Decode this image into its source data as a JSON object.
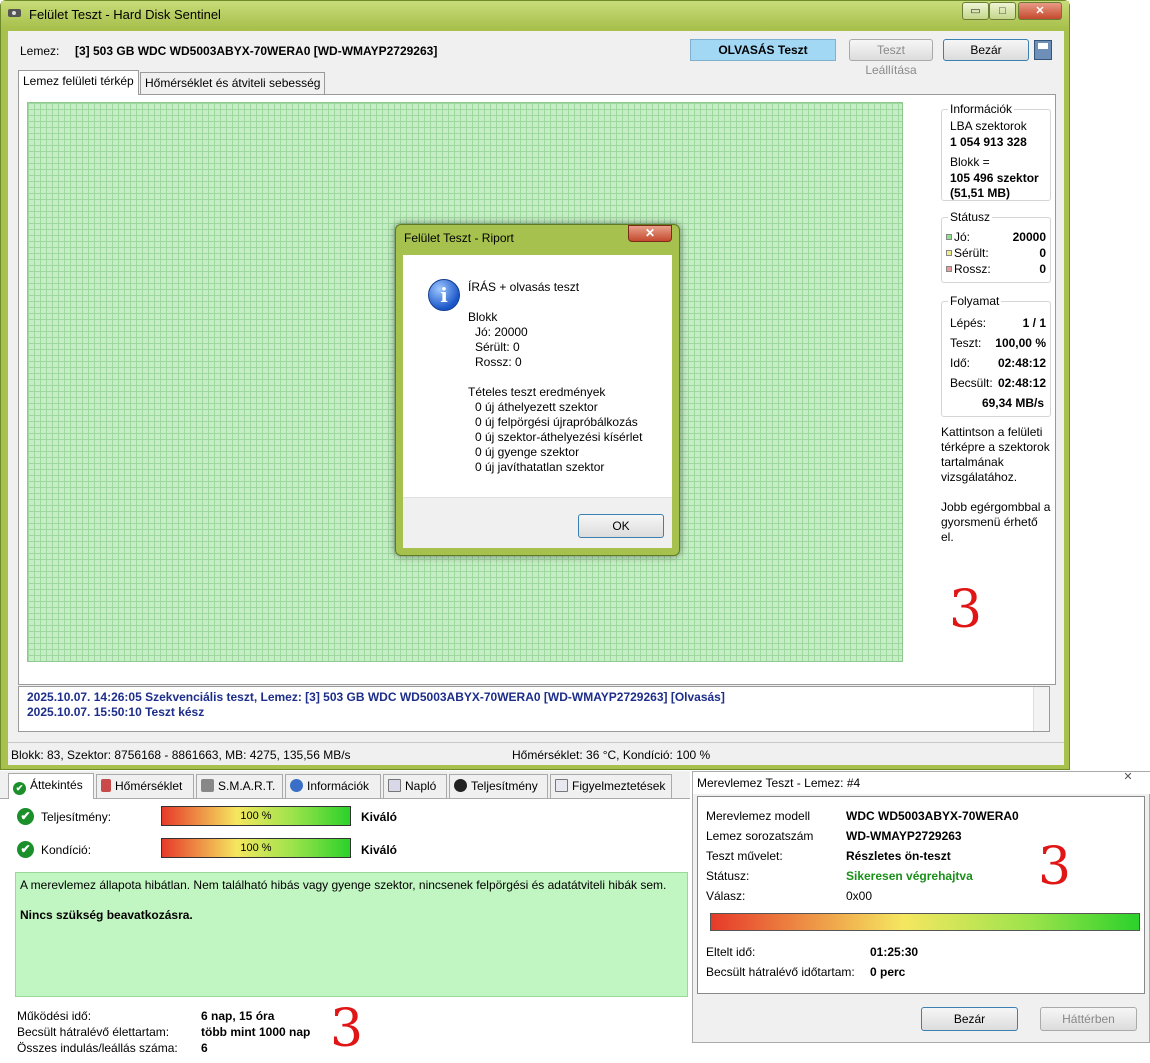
{
  "window": {
    "title": "Felület Teszt - Hard Disk Sentinel",
    "lemez_label": "Lemez:",
    "lemez_value": "[3] 503 GB  WDC WD5003ABYX-70WERA0 [WD-WMAYP2729263]",
    "test_mode": "OLVASÁS Teszt",
    "stop_button": "Teszt Leállítása",
    "close_button": "Bezár",
    "caption_buttons": [
      "▭",
      "□",
      "✕"
    ]
  },
  "tabs": [
    "Lemez felületi térkép",
    "Hőmérséklet és átviteli sebesség"
  ],
  "info": {
    "title": "Információk",
    "lba_label": "LBA szektorok",
    "lba_value": "1 054 913 328",
    "block_label": "Blokk =",
    "block_value": "105 496 szektor",
    "block_mb": "(51,51 MB)"
  },
  "status": {
    "title": "Státusz",
    "items": [
      {
        "label": "Jó:",
        "value": "20000",
        "color": "#8fe08f"
      },
      {
        "label": "Sérült:",
        "value": "0",
        "color": "#f2ec8a"
      },
      {
        "label": "Rossz:",
        "value": "0",
        "color": "#e99a9a"
      }
    ]
  },
  "progress": {
    "title": "Folyamat",
    "rows": [
      {
        "label": "Lépés:",
        "value": "1 / 1"
      },
      {
        "label": "Teszt:",
        "value": "100,00 %"
      },
      {
        "label": "Idő:",
        "value": "02:48:12"
      },
      {
        "label": "Becsült:",
        "value": "02:48:12"
      }
    ],
    "speed": "69,34 MB/s"
  },
  "hints": {
    "click": "Kattintson a felületi térképre a szektorok tartalmának vizsgálatához.",
    "rightclick": "Jobb egérgombbal a gyorsmenü érhető el."
  },
  "log": [
    "2025.10.07.  14:26:05   Szekvenciális teszt, Lemez: [3] 503 GB  WDC WD5003ABYX-70WERA0 [WD-WMAYP2729263] [Olvasás]",
    "2025.10.07.  15:50:10   Teszt kész"
  ],
  "statusbar": {
    "left": "Blokk: 83, Szektor: 8756168 - 8861663, MB: 4275, 135,56 MB/s",
    "right": "Hőmérséklet: 36  °C,  Kondíció: 100 %"
  },
  "report": {
    "title": "Felület Teszt - Riport",
    "close_glyph": "✕",
    "heading": "ÍRÁS + olvasás teszt",
    "block_title": "Blokk",
    "block_lines": [
      "Jó: 20000",
      "Sérült: 0",
      "Rossz: 0"
    ],
    "results_title": "Tételes teszt eredmények",
    "results": [
      "0 új áthelyezett szektor",
      "0 új felpörgési újrapróbálkozás",
      "0 új szektor-áthelyezési kísérlet",
      "0 új gyenge szektor",
      "0 új javíthatatlan szektor"
    ],
    "ok": "OK"
  },
  "overview": {
    "tabs": [
      "Áttekintés",
      "Hőmérséklet",
      "S.M.A.R.T.",
      "Információk",
      "Napló",
      "Teljesítmény",
      "Figyelmeztetések"
    ],
    "perf_label": "Teljesítmény:",
    "perf_value": "100 %",
    "perf_text": "Kiváló",
    "cond_label": "Kondíció:",
    "cond_value": "100 %",
    "cond_text": "Kiváló",
    "perf_fraction": 1.0,
    "cond_fraction": 1.0,
    "message": "A merevlemez állapota hibátlan. Nem található hibás vagy gyenge szektor, nincsenek felpörgési és adatátviteli hibák sem.",
    "action": "Nincs szükség beavatkozásra.",
    "stats": [
      {
        "label": "Működési idő:",
        "value": "6 nap, 15 óra"
      },
      {
        "label": "Becsült hátralévő élettartam:",
        "value": "több mint 1000 nap"
      },
      {
        "label": "Összes indulás/leállás száma:",
        "value": "6"
      }
    ]
  },
  "selftest": {
    "title": "Merevlemez Teszt - Lemez: #4",
    "close_glyph": "✕",
    "rows": [
      {
        "label": "Merevlemez modell",
        "value": "WDC WD5003ABYX-70WERA0"
      },
      {
        "label": "Lemez sorozatszám",
        "value": "WD-WMAYP2729263"
      },
      {
        "label": "Teszt művelet:",
        "value": "Részletes ön-teszt"
      },
      {
        "label": "Státusz:",
        "value": "Sikeresen végrehajtva"
      },
      {
        "label": "Válasz:",
        "value": "0x00"
      }
    ],
    "progress_fraction": 1.0,
    "elapsed_label": "Eltelt idő:",
    "elapsed_value": "01:25:30",
    "remaining_label": "Becsült hátralévő időtartam:",
    "remaining_value": "0 perc",
    "close_button": "Bezár",
    "bg_button": "Háttérben",
    "status_color": "#1a8f1a"
  },
  "annotations": {
    "mark": "3"
  }
}
